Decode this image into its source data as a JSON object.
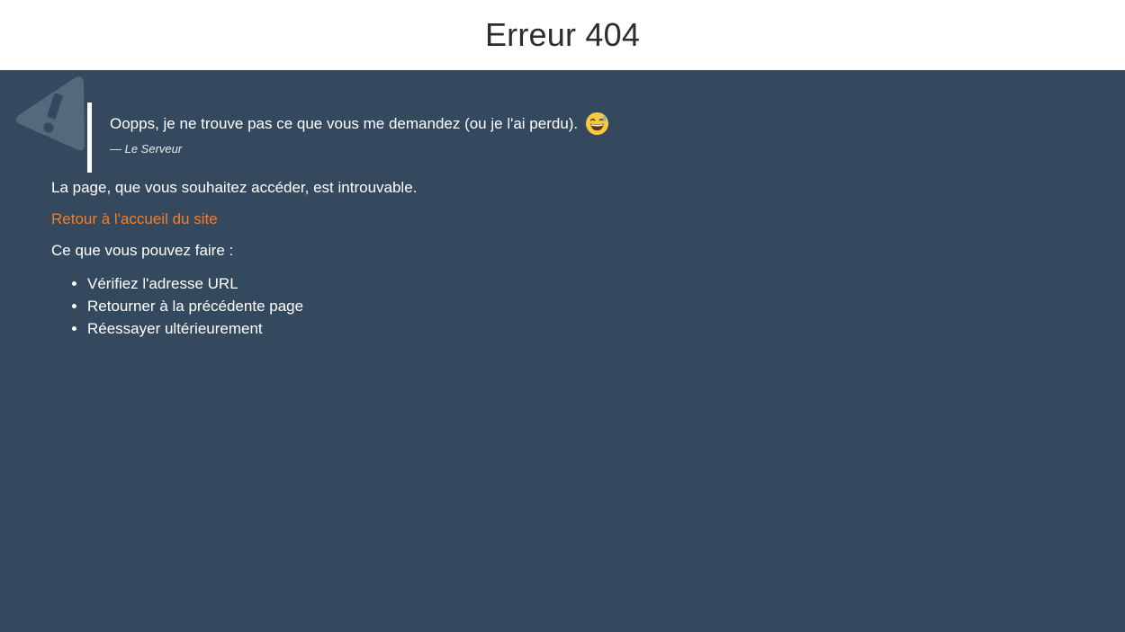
{
  "header": {
    "title": "Erreur 404"
  },
  "quote": {
    "text": "Oopps, je ne trouve pas ce que vous me demandez (ou je l'ai perdu).",
    "emoji": "grinning-face-with-sweat-icon",
    "author": "— Le Serveur"
  },
  "content": {
    "message": "La page, que vous souhaitez accéder, est introuvable.",
    "home_link": "Retour à l'accueil du site",
    "tips_heading": "Ce que vous pouvez faire :",
    "tips": [
      "Vérifiez l'adresse URL",
      "Retourner à la précédente page",
      "Réessayer ultérieurement"
    ]
  },
  "colors": {
    "background": "#34495e",
    "header_background": "#ffffff",
    "link": "#ee7d2f",
    "text": "#ffffff"
  },
  "icons": {
    "decorative": "warning-triangle-icon"
  }
}
